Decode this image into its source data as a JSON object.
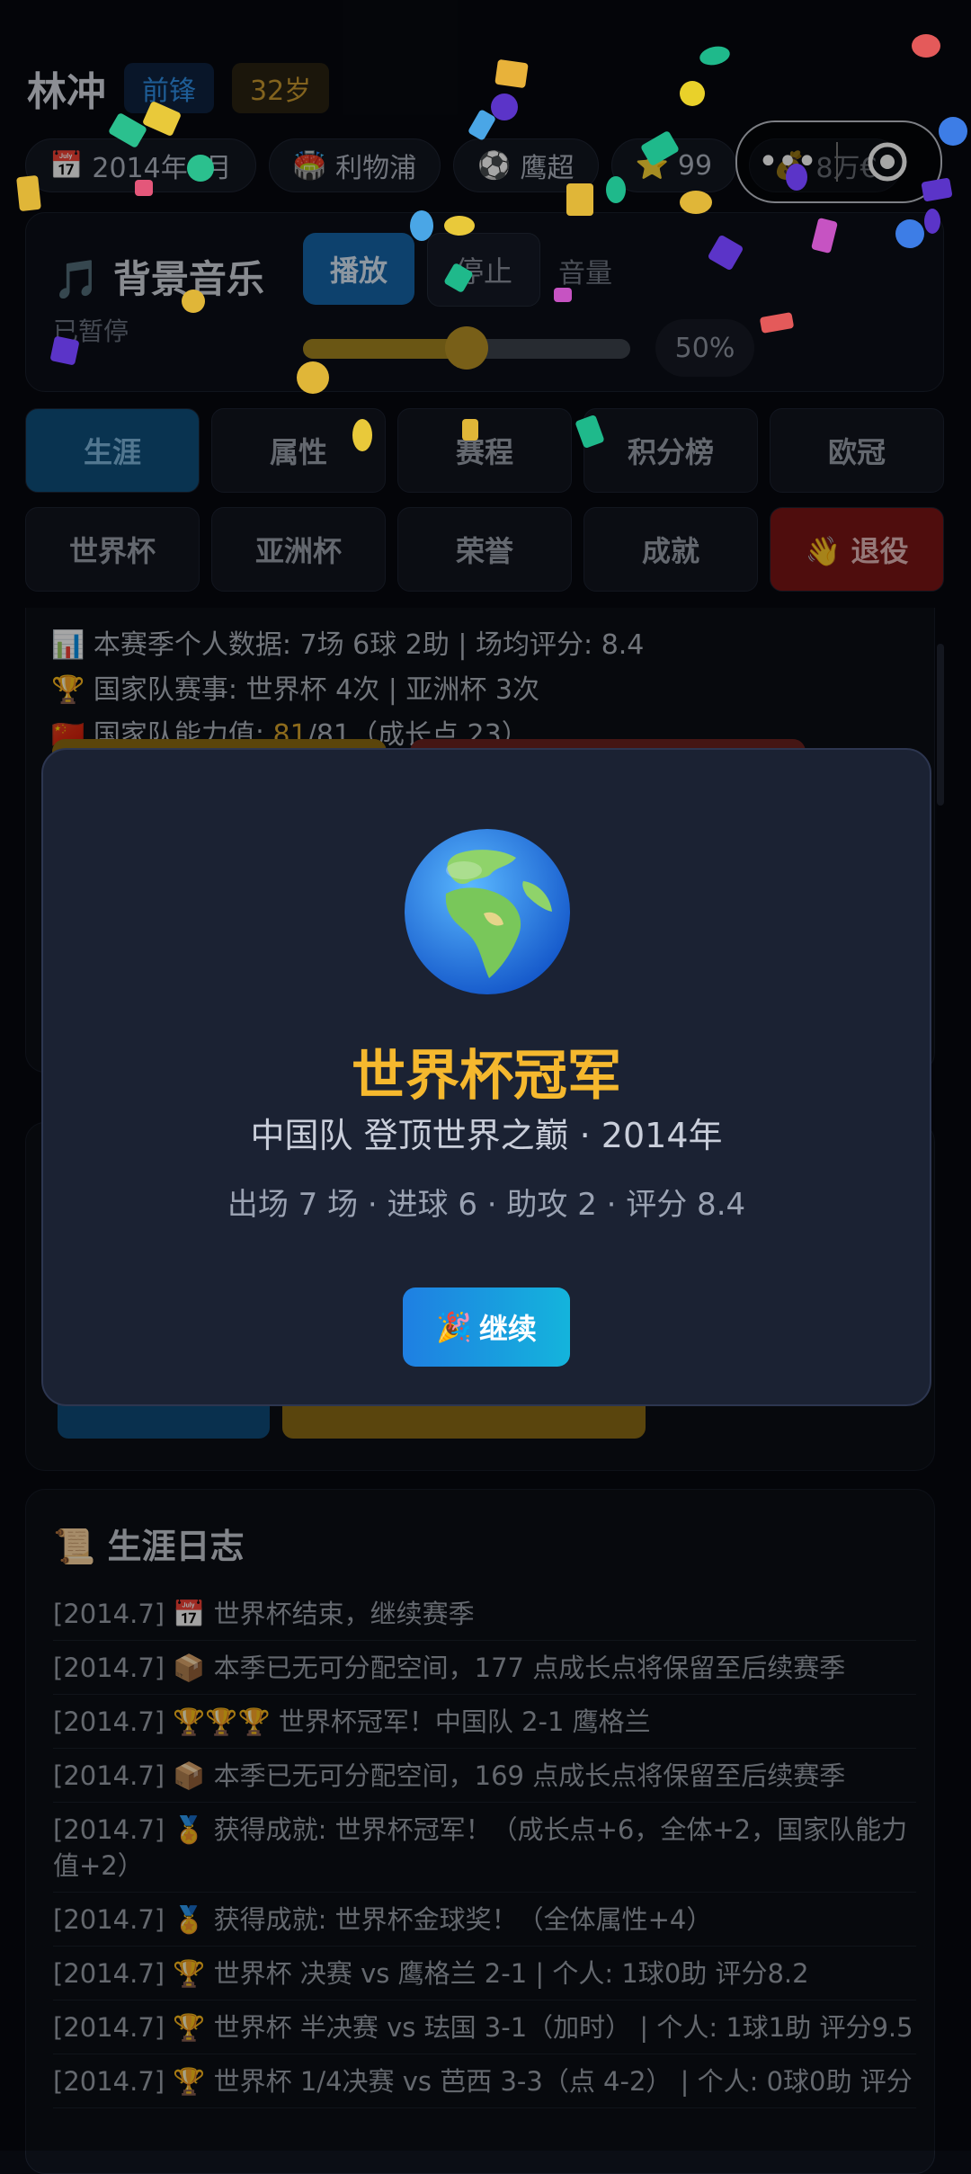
{
  "player": {
    "name": "林冲",
    "position": "前锋",
    "age": "32岁"
  },
  "chips": [
    {
      "icon": "📅",
      "label": "2014年8月"
    },
    {
      "icon": "🏟️",
      "label": "利物浦"
    },
    {
      "icon": "⚽",
      "label": "鹰超"
    },
    {
      "icon": "⭐",
      "label": "99"
    },
    {
      "icon": "💰",
      "label": "8万€"
    }
  ],
  "capsule": {
    "more": "•••"
  },
  "music": {
    "icon": "🎵",
    "title": "背景音乐",
    "status": "已暂停",
    "play_label": "播放",
    "stop_label": "停止",
    "volume_label": "音量",
    "volume_percent": "50%",
    "volume_value": 0.5
  },
  "tabs": [
    {
      "label": "生涯"
    },
    {
      "label": "属性"
    },
    {
      "label": "赛程"
    },
    {
      "label": "积分榜"
    },
    {
      "label": "欧冠"
    },
    {
      "label": "世界杯"
    },
    {
      "label": "亚洲杯"
    },
    {
      "label": "荣誉"
    },
    {
      "label": "成就"
    },
    {
      "label": "👋 退役"
    }
  ],
  "stats": {
    "line1": "📊 本赛季个人数据: 7场 6球 2助 | 场均评分: 8.4",
    "line2": "🏆 国家队赛事: 世界杯 4次 | 亚洲杯 3次",
    "line3_prefix": "🇨🇳 国家队能力值: ",
    "line3_value": "81",
    "line3_suffix": "/81（成长点 23）"
  },
  "log": {
    "title": "📜 生涯日志",
    "entries": [
      "[2014.7] 📅 世界杯结束，继续赛季",
      "[2014.7] 📦 本季已无可分配空间，177 点成长点将保留至后续赛季",
      "[2014.7] 🏆🏆🏆 世界杯冠军！中国队 2-1 鹰格兰",
      "[2014.7] 📦 本季已无可分配空间，169 点成长点将保留至后续赛季",
      "[2014.7] 🏅 获得成就: 世界杯冠军！（成长点+6，全体+2，国家队能力值+2）",
      "[2014.7] 🏅 获得成就: 世界杯金球奖！（全体属性+4）",
      "[2014.7] 🏆 世界杯 决赛 vs 鹰格兰 2-1 | 个人: 1球0助 评分8.2",
      "[2014.7] 🏆 世界杯 半决赛 vs 珐国 3-1（加时） | 个人: 1球1助 评分9.5",
      "[2014.7] 🏆 世界杯 1/4决赛 vs 芭西 3-3（点 4-2） | 个人: 0球0助 评分"
    ]
  },
  "modal": {
    "title": "世界杯冠军",
    "subtitle": "中国队 登顶世界之巅 · 2014年",
    "stats": "出场 7 场 · 进球 6 · 助攻 2 · 评分 8.4",
    "button_icon": "🎉",
    "button_label": "继续"
  },
  "colors": {
    "accent_gold": "#f5b82e",
    "button_blue": "#1f7fe2",
    "danger_red": "#7a1414"
  }
}
